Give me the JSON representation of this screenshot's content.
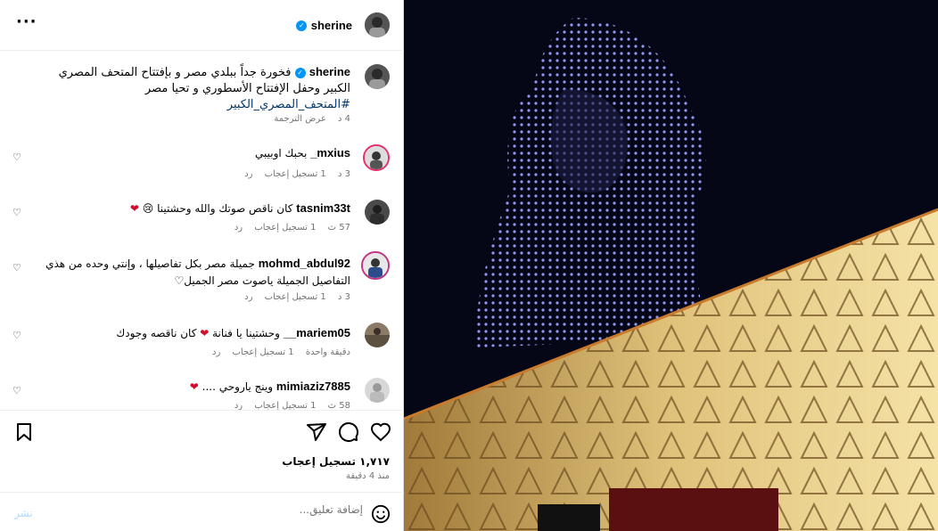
{
  "header": {
    "username": "sherine",
    "more_label": "···"
  },
  "caption": {
    "username": "sherine",
    "text": "فخورة جداً ببلدي مصر و بإفتتاح المتحف المصري الكبير وحفل الإفتتاح الأسطوري و تحيا مصر",
    "hashtag": "#المتحف_المصري_الكبير",
    "age": "4 د",
    "translate": "عرض الترجمة"
  },
  "comments": [
    {
      "username": "mxius_",
      "text": "بحبك اوبيبي",
      "age": "3 د",
      "likes": "1 تسجيل إعجاب",
      "reply": "رد"
    },
    {
      "username": "tasnim33t",
      "text": "كان ناقص صوتك والله وحشتينا 😢",
      "heart": "❤",
      "age": "57 ث",
      "likes": "1 تسجيل إعجاب",
      "reply": "رد"
    },
    {
      "username": "mohmd_abdul92",
      "text": "جميلة مصر بكل تفاصيلها ، وإنتي وحده من هذي التفاصيل الجميلة ياصوت مصر الجميل♡",
      "age": "3 د",
      "likes": "1 تسجيل إعجاب",
      "reply": "رد"
    },
    {
      "username": "mariem05__",
      "text": "وحشتينا يا فنانة",
      "heart": "❤",
      "text2": "كان ناقصه وجودك",
      "age": "دقيقة واحدة",
      "likes": "1 تسجيل إعجاب",
      "reply": "رد"
    },
    {
      "username": "mimiaziz7885",
      "text": "وينج ياروحي ....",
      "heart": "❤",
      "age": "58 ث",
      "likes": "1 تسجيل إعجاب",
      "reply": "رد"
    }
  ],
  "actions": {
    "likes": "١,٧١٧ تسجيل إعجاب",
    "time": "منذ 4 دقيقة"
  },
  "add_comment": {
    "placeholder": "إضافة تعليق...",
    "post": "نشر"
  },
  "icons": {
    "more": "more-icon",
    "bookmark": "bookmark-icon",
    "share": "share-icon",
    "comment": "comment-icon",
    "like": "heart-icon",
    "emoji": "smiley-icon",
    "verified": "verified-badge-icon"
  },
  "colors": {
    "verified": "#0095f6",
    "link": "#00376b",
    "post_disabled": "#b3dbff",
    "heart_red": "#d0102a"
  }
}
